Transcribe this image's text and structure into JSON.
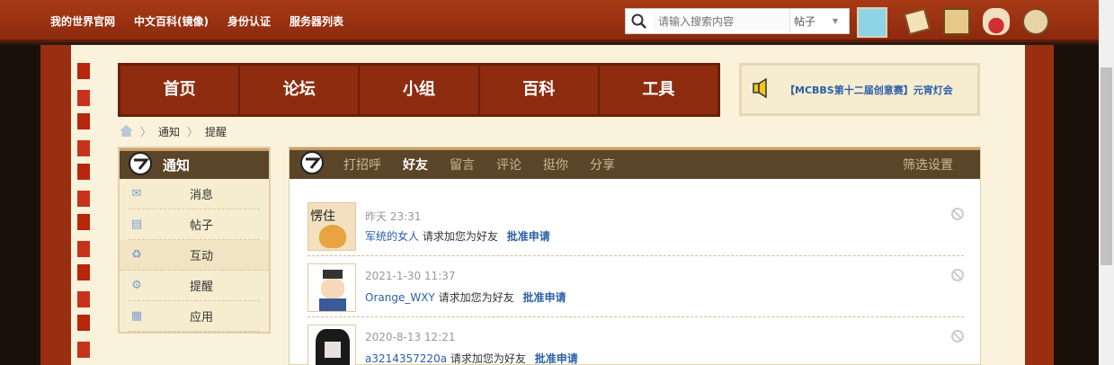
{
  "topnav": {
    "items": [
      "我的世界官网",
      "中文百科(镜像)",
      "身份认证",
      "服务器列表"
    ]
  },
  "search": {
    "placeholder": "请输入搜索内容",
    "type": "帖子"
  },
  "mainnav": {
    "items": [
      "首页",
      "论坛",
      "小组",
      "百科",
      "工具"
    ]
  },
  "announcement": {
    "text": "【MCBBS第十二届创意赛】元宵灯会"
  },
  "breadcrumb": {
    "items": [
      "通知",
      "提醒"
    ]
  },
  "leftmenu": {
    "title": "通知",
    "items": [
      {
        "label": "消息",
        "icon": "envelope-icon"
      },
      {
        "label": "帖子",
        "icon": "document-icon"
      },
      {
        "label": "互动",
        "icon": "recycle-icon"
      },
      {
        "label": "提醒",
        "icon": "gear-icon"
      },
      {
        "label": "应用",
        "icon": "grid-icon"
      }
    ]
  },
  "tabs": {
    "items": [
      "打招呼",
      "好友",
      "留言",
      "评论",
      "挺你",
      "分享"
    ],
    "current": "好友",
    "filter": "筛选设置"
  },
  "notices": [
    {
      "time": "昨天 23:31",
      "user": "军统的女人",
      "action": "请求加您为好友",
      "approve": "批准申请",
      "avatar_text": "愣住"
    },
    {
      "time": "2021-1-30 11:37",
      "user": "Orange_WXY",
      "action": "请求加您为好友",
      "approve": "批准申请",
      "avatar_text": ""
    },
    {
      "time": "2020-8-13 12:21",
      "user": "a3214357220a",
      "action": "请求加您为好友",
      "approve": "批准申请",
      "avatar_text": ""
    }
  ]
}
